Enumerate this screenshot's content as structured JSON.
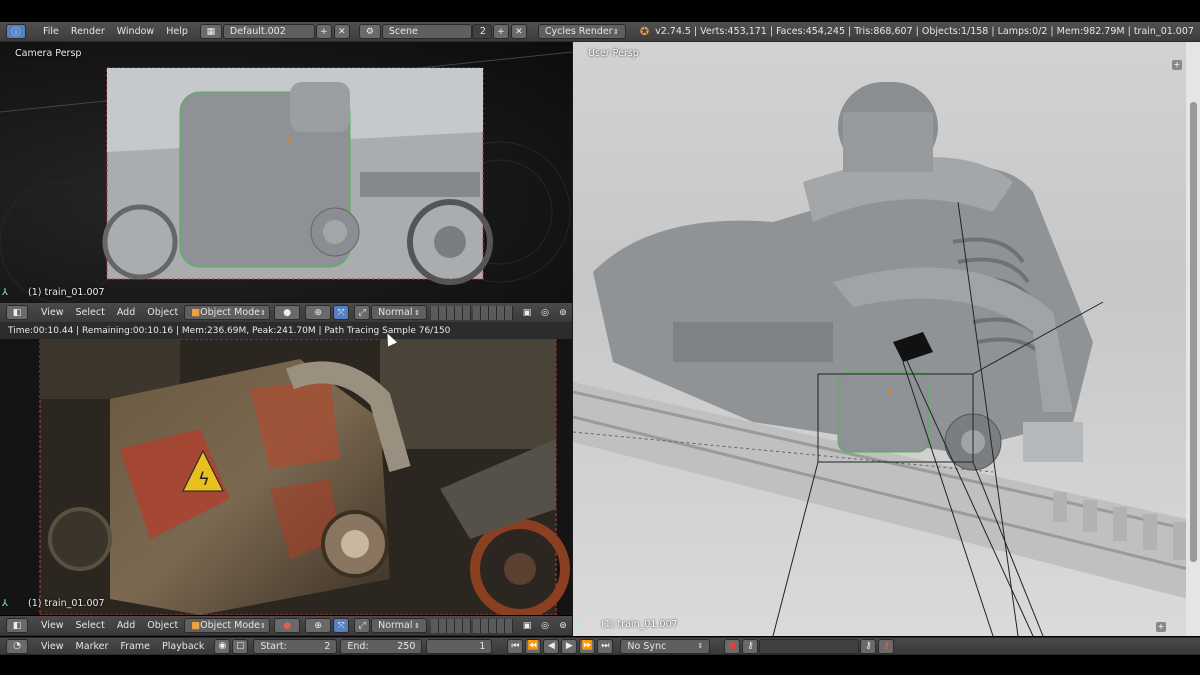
{
  "topbar": {
    "menus": [
      "File",
      "Render",
      "Window",
      "Help"
    ],
    "screen_layout": "Default.002",
    "scene": "Scene",
    "scene_users": "2",
    "render_engine": "Cycles Render",
    "stats": "v2.74.5 | Verts:453,171 | Faces:454,245 | Tris:868,607 | Objects:1/158 | Lamps:0/2 | Mem:982.79M | train_01.007"
  },
  "camera_view": {
    "label": "Camera Persp",
    "object_label": "(1) train_01.007"
  },
  "camera_header": {
    "menus": [
      "View",
      "Select",
      "Add",
      "Object"
    ],
    "mode": "Object Mode",
    "orientation": "Normal"
  },
  "render_status": "Time:00:10.44 | Remaining:00:10.16 | Mem:236.69M, Peak:241.70M | Path Tracing Sample 76/150",
  "render_view": {
    "object_label": "(1) train_01.007"
  },
  "render_header": {
    "menus": [
      "View",
      "Select",
      "Add",
      "Object"
    ],
    "mode": "Object Mode",
    "orientation": "Normal"
  },
  "user_view": {
    "label": "User Persp",
    "object_label": "(1) train_01.007"
  },
  "timeline": {
    "menus": [
      "View",
      "Marker",
      "Frame",
      "Playback"
    ],
    "start_label": "Start:",
    "start_value": "2",
    "end_label": "End:",
    "end_value": "250",
    "current_frame": "1",
    "sync": "No Sync"
  },
  "colors": {
    "header": "#454545",
    "accent_blue": "#5680c2",
    "selection_green": "#4cb84c",
    "camera_border": "#c43c3c"
  }
}
